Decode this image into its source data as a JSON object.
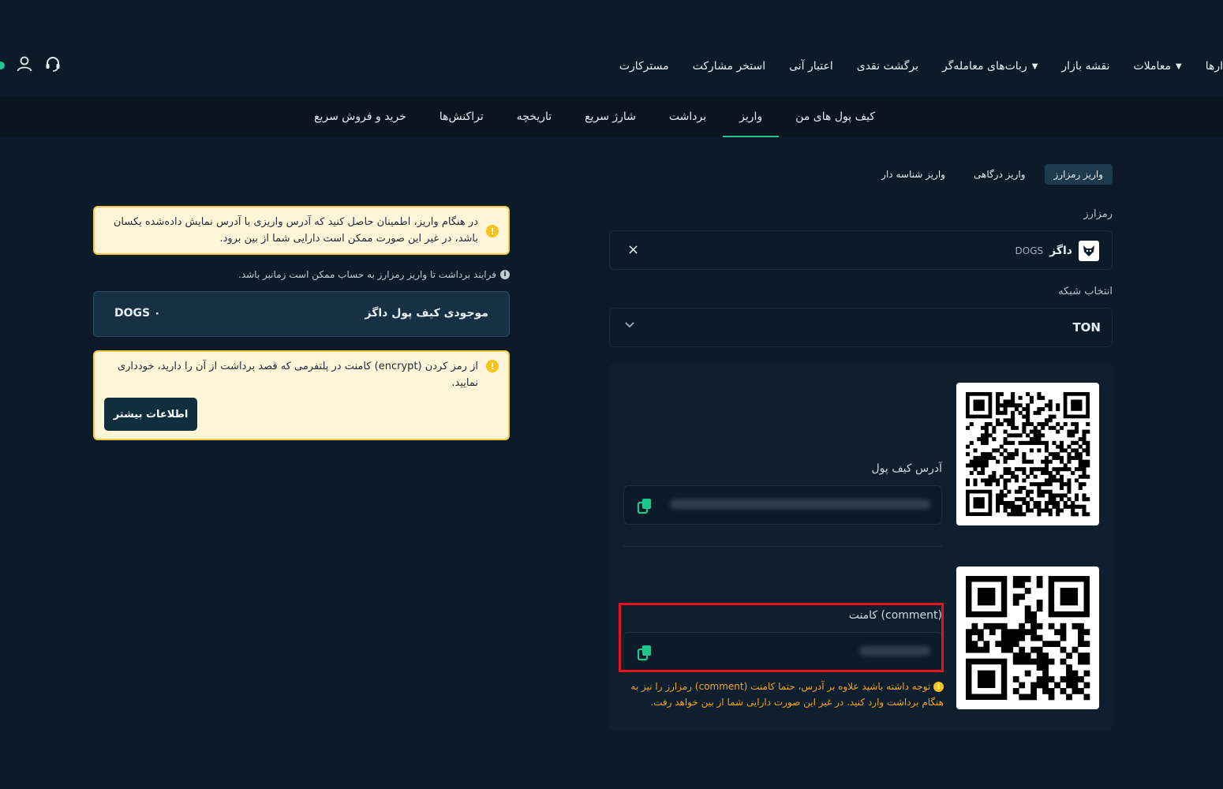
{
  "topnav": {
    "items": [
      {
        "label": "ارها",
        "caret": false
      },
      {
        "label": "معاملات",
        "caret": true
      },
      {
        "label": "نقشه بازار",
        "caret": false
      },
      {
        "label": "ربات‌های معامله‌گر",
        "caret": true
      },
      {
        "label": "برگشت نقدی",
        "caret": false
      },
      {
        "label": "اعتبار آنی",
        "caret": false
      },
      {
        "label": "استخر مشارکت",
        "caret": false
      },
      {
        "label": "مسترکارت",
        "caret": false
      }
    ]
  },
  "subnav": {
    "tabs": [
      "کیف پول های من",
      "واریز",
      "برداشت",
      "شارژ سریع",
      "تاریخچه",
      "تراکنش‌ها",
      "خرید و فروش سریع"
    ],
    "active_index": 1
  },
  "deposit_types": [
    "واریز رمزارز",
    "واریز درگاهی",
    "واریز شناسه دار"
  ],
  "coin": {
    "label": "رمزارز",
    "name": "داگز",
    "symbol": "DOGS",
    "logo": "dog-icon",
    "clear": "×"
  },
  "network": {
    "label": "انتخاب شبکه",
    "value": "TON",
    "chevron": "⌄"
  },
  "address": {
    "label": "آدرس کیف پول"
  },
  "comment": {
    "label": "کامنت (comment)",
    "warning": "توجه داشته باشید علاوه بر آدرس، حتما کامنت (comment) رمزارز را نیز به هنگام برداشت وارد کنید. در غیر این صورت دارایی شما از بین خواهد رفت."
  },
  "notices": {
    "address_match": "در هنگام واریز، اطمینان حاصل کنید که آدرس واریزی با آدرس نمایش داده‌شده یکسان باشد، در غیر این صورت ممکن است دارایی شما از بین برود.",
    "process_time": "فرایند برداشت تا واریز رمزارز به حساب ممکن است زمانبر باشد.",
    "encrypt": "از رمز کردن (encrypt) کامنت در پلتفرمی که قصد برداشت از آن را دارید، خودداری نمایید.",
    "more_info": "اطلاعات بیشتر"
  },
  "balance": {
    "title": "موجودی کیف پول داگز",
    "amount": "DOGS ۰"
  },
  "colors": {
    "background": "#0c1a29",
    "accent": "#21c48a",
    "warning": "#f3a51e",
    "highlight": "#e8141b"
  }
}
